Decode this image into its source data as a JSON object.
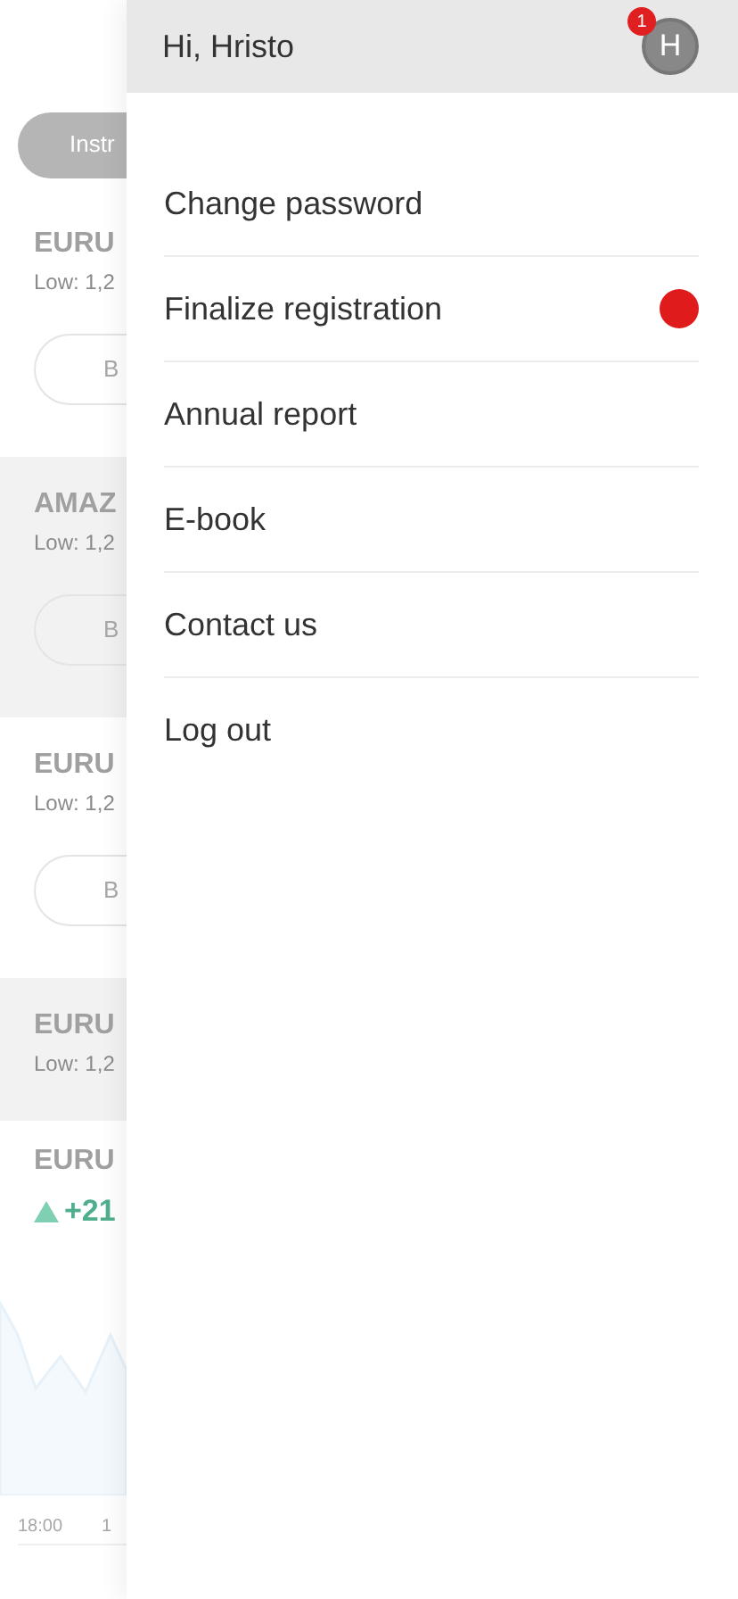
{
  "background": {
    "tab_label": "Instr",
    "cards": [
      {
        "kind": "quote",
        "symbol": "EURU",
        "low": "Low: 1,2",
        "button": "B",
        "shaded": false
      },
      {
        "kind": "quote",
        "symbol": "AMAZ",
        "low": "Low: 1,2",
        "button": "B",
        "shaded": true
      },
      {
        "kind": "quote",
        "symbol": "EURU",
        "low": "Low: 1,2",
        "button": "B",
        "shaded": false
      },
      {
        "kind": "quote",
        "symbol": "EURU",
        "low": "Low: 1,2",
        "shaded": true
      },
      {
        "kind": "chart",
        "symbol": "EURU",
        "change": "+21",
        "time_labels": [
          "18:00",
          "1"
        ],
        "shaded": false
      }
    ]
  },
  "drawer": {
    "greeting": "Hi, Hristo",
    "avatar_initial": "H",
    "notification_count": "1",
    "menu": [
      {
        "label": "Change password",
        "alert": false
      },
      {
        "label": "Finalize registration",
        "alert": true
      },
      {
        "label": "Annual report",
        "alert": false
      },
      {
        "label": "E-book",
        "alert": false
      },
      {
        "label": "Contact us",
        "alert": false
      },
      {
        "label": "Log out",
        "alert": false
      }
    ]
  }
}
